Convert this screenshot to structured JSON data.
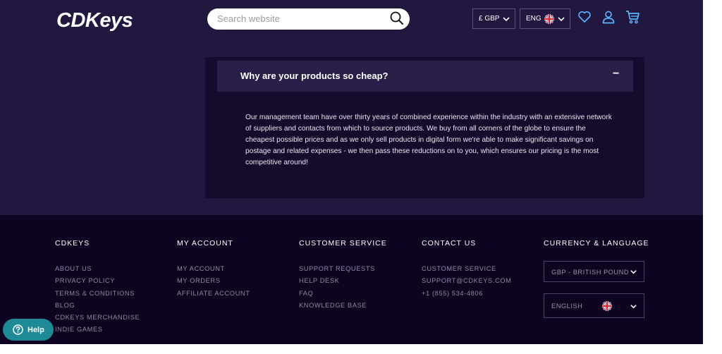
{
  "header": {
    "logo_text": "CDKeys",
    "search_placeholder": "Search website",
    "currency_selector": "£ GBP",
    "language_selector": "ENG",
    "icons": [
      "heart-icon",
      "user-icon",
      "cart-icon"
    ]
  },
  "faq": {
    "question": "Why are your products so cheap?",
    "toggle": "−",
    "answer": "Our management team have over thirty years of combined experience within the industry with an extensive network of suppliers and contacts from which to source products. We buy from all corners of the globe to ensure the cheapest possible prices and as we only sell products in digital form we're able to make significant savings on postage and related expenses - we then pass these reductions on to you, which ensures our pricing is the most competitive around!"
  },
  "footer": {
    "cdkeys": {
      "heading": "CDKEYS",
      "links": [
        "ABOUT US",
        "PRIVACY POLICY",
        "TERMS & CONDITIONS",
        "BLOG",
        "CDKEYS MERCHANDISE",
        "INDIE GAMES"
      ]
    },
    "account": {
      "heading": "MY ACCOUNT",
      "links": [
        "MY ACCOUNT",
        "MY ORDERS",
        "AFFILIATE ACCOUNT"
      ]
    },
    "service": {
      "heading": "CUSTOMER SERVICE",
      "links": [
        "SUPPORT REQUESTS",
        "HELP DESK",
        "FAQ",
        "KNOWLEDGE BASE"
      ]
    },
    "contact": {
      "heading": "CONTACT US",
      "links": [
        "CUSTOMER SERVICE",
        "SUPPORT@CDKEYS.COM",
        "+1 (855) 534-4806"
      ]
    },
    "currency_language": {
      "heading": "CURRENCY & LANGUAGE",
      "currency": "GBP - BRITISH POUND",
      "language": "ENGLISH"
    }
  },
  "help_button": "Help",
  "colors": {
    "page_bg": "#22173f",
    "footer_bg": "#0c0420",
    "card_bg": "#150b2c",
    "help_bg": "#1e8a96",
    "icon_blue": "#5ab4ff"
  }
}
